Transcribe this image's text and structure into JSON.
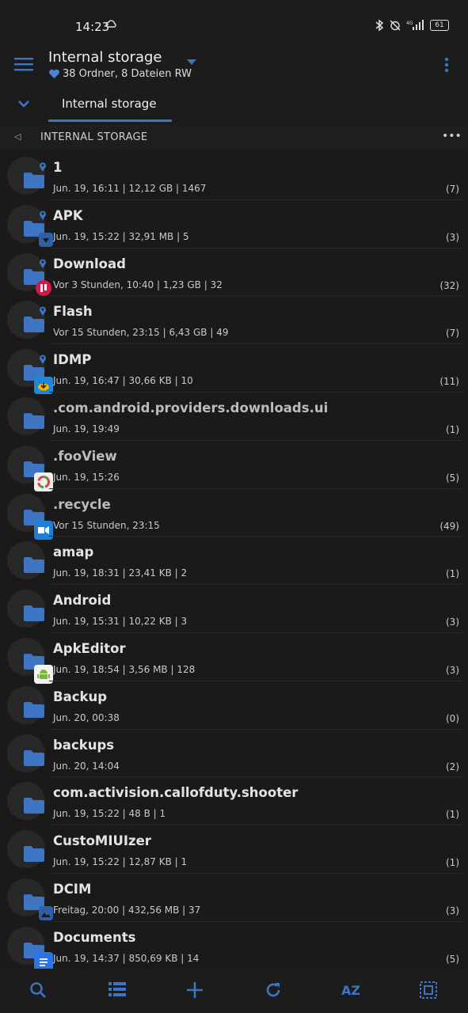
{
  "status": {
    "time": "14:23",
    "battery": "61"
  },
  "header": {
    "title": "Internal storage",
    "subtitle": "38 Ordner, 8 Dateien RW"
  },
  "tabs": [
    {
      "label": "Internal storage"
    }
  ],
  "path": {
    "label": "INTERNAL STORAGE"
  },
  "colors": {
    "accent": "#3d74c4",
    "folder": "#3d74c4",
    "background": "#1a1a1a"
  },
  "files": [
    {
      "name": "1",
      "meta": "Jun. 19, 16:11 | 12,12 GB | 1467",
      "count": "(7)",
      "pin": true,
      "badge": null
    },
    {
      "name": "APK",
      "meta": "Jun. 19, 15:22 | 32,91 MB | 5",
      "count": "(3)",
      "pin": true,
      "badge": "apk-badge-icon"
    },
    {
      "name": "Download",
      "meta": "Vor 3 Stunden, 10:40 | 1,23 GB | 32",
      "count": "(32)",
      "pin": true,
      "badge": "download-app-badge-icon"
    },
    {
      "name": "Flash",
      "meta": "Vor 15 Stunden, 23:15 | 6,43 GB | 49",
      "count": "(7)",
      "pin": true,
      "badge": null
    },
    {
      "name": "IDMP",
      "meta": "Jun. 19, 16:47 | 30,66 KB | 10",
      "count": "(11)",
      "pin": true,
      "badge": "idm-badge-icon"
    },
    {
      "name": ".com.android.providers.downloads.ui",
      "meta": "Jun. 19, 19:49",
      "count": "(1)",
      "pin": false,
      "badge": null
    },
    {
      "name": ".fooView",
      "meta": "Jun. 19, 15:26",
      "count": "(5)",
      "pin": false,
      "badge": "fooview-badge-icon"
    },
    {
      "name": ".recycle",
      "meta": "Vor 15 Stunden, 23:15",
      "count": "(49)",
      "pin": false,
      "badge": "recycle-app-badge-icon"
    },
    {
      "name": "amap",
      "meta": "Jun. 19, 18:31 | 23,41 KB | 2",
      "count": "(1)",
      "pin": false,
      "badge": null
    },
    {
      "name": "Android",
      "meta": "Jun. 19, 15:31 | 10,22 KB | 3",
      "count": "(3)",
      "pin": false,
      "badge": null
    },
    {
      "name": "ApkEditor",
      "meta": "Jun. 19, 18:54 | 3,56 MB | 128",
      "count": "(3)",
      "pin": false,
      "badge": "android-badge-icon"
    },
    {
      "name": "Backup",
      "meta": "Jun. 20, 00:38",
      "count": "(0)",
      "pin": false,
      "badge": null
    },
    {
      "name": "backups",
      "meta": "Jun. 20, 14:04",
      "count": "(2)",
      "pin": false,
      "badge": null
    },
    {
      "name": "com.activision.callofduty.shooter",
      "meta": "Jun. 19, 15:22 | 48 B | 1",
      "count": "(1)",
      "pin": false,
      "badge": null
    },
    {
      "name": "CustoMIUIzer",
      "meta": "Jun. 19, 15:22 | 12,87 KB | 1",
      "count": "(1)",
      "pin": false,
      "badge": null
    },
    {
      "name": "DCIM",
      "meta": "Freitag, 20:00 | 432,56 MB | 37",
      "count": "(3)",
      "pin": false,
      "badge": "image-badge-icon"
    },
    {
      "name": "Documents",
      "meta": "Jun. 19, 14:37 | 850,69 KB | 14",
      "count": "(5)",
      "pin": false,
      "badge": "document-badge-icon"
    }
  ],
  "bottombar": {
    "sort_label": "AZ",
    "icons": [
      "search-icon",
      "list-view-icon",
      "add-icon",
      "refresh-icon",
      "sort-az-icon",
      "select-all-icon"
    ]
  }
}
